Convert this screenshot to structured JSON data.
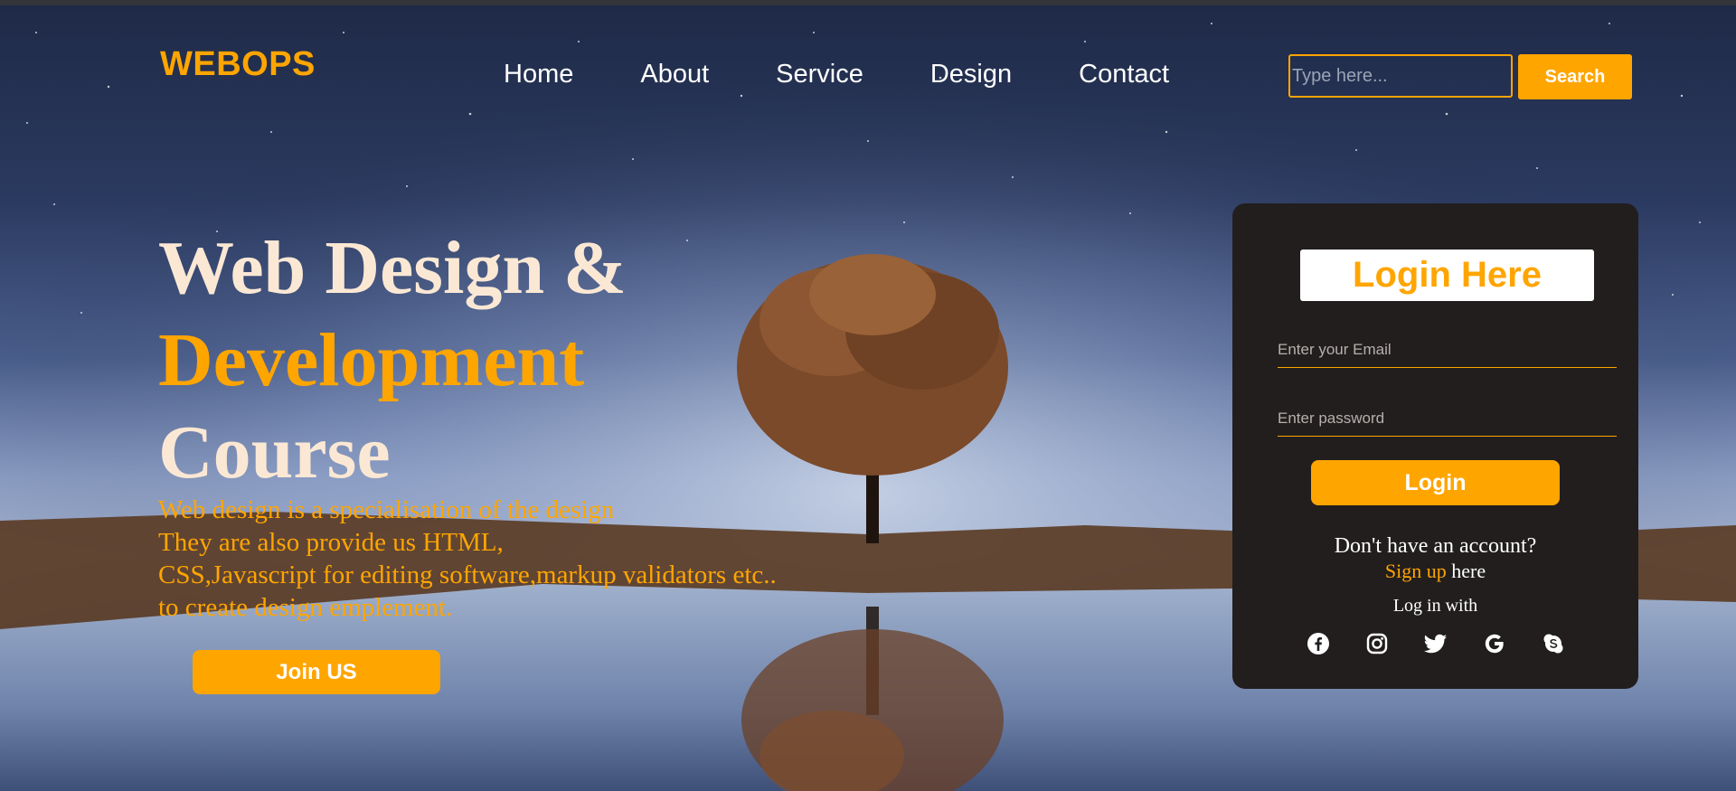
{
  "brand": {
    "logo": "WEBOPS",
    "accent_color": "#ffa500"
  },
  "nav": {
    "items": [
      {
        "label": "Home"
      },
      {
        "label": "About"
      },
      {
        "label": "Service"
      },
      {
        "label": "Design"
      },
      {
        "label": "Contact"
      }
    ]
  },
  "search": {
    "placeholder": "Type here...",
    "button_label": "Search"
  },
  "hero": {
    "title_line1": "Web Design &",
    "title_line2": "Development",
    "title_line3": "Course",
    "description_lines": [
      "Web design is a specialisation of the design",
      "They are also provide us HTML,",
      "CSS,Javascript for editing software,markup validators etc..",
      "to create design emplement."
    ],
    "join_button": "Join US"
  },
  "login": {
    "title": "Login Here",
    "email_placeholder": "Enter your Email",
    "password_placeholder": "Enter password",
    "button_label": "Login",
    "no_account": "Don't have an account?",
    "signup_link": "Sign up",
    "signup_suffix": " here",
    "login_with": "Log in with",
    "social_icons": [
      "facebook-icon",
      "instagram-icon",
      "twitter-icon",
      "google-icon",
      "skype-icon"
    ],
    "card_background": "#221e1e"
  }
}
